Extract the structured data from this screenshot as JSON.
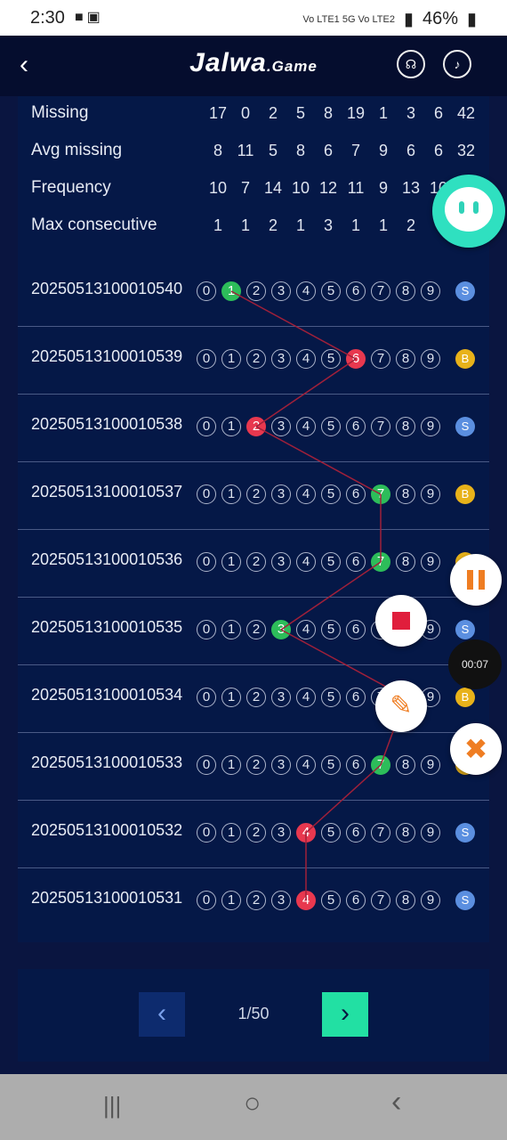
{
  "status_bar": {
    "time": "2:30",
    "left_icons": [
      "video-camera-icon",
      "image-icon"
    ],
    "network_label": "Vo LTE1 5G Vo LTE2",
    "battery": "46%"
  },
  "header": {
    "logo_main": "Jalwa",
    "logo_suffix": ".Game",
    "back_icon": "‹"
  },
  "stats": [
    {
      "label": "Missing",
      "values": [
        "17",
        "0",
        "2",
        "5",
        "8",
        "19",
        "1",
        "3",
        "6",
        "42"
      ]
    },
    {
      "label": "Avg missing",
      "values": [
        "8",
        "11",
        "5",
        "8",
        "6",
        "7",
        "9",
        "6",
        "6",
        "32"
      ]
    },
    {
      "label": "Frequency",
      "values": [
        "10",
        "7",
        "14",
        "10",
        "12",
        "11",
        "9",
        "13",
        "10",
        ""
      ]
    },
    {
      "label": "Max consecutive",
      "values": [
        "1",
        "1",
        "2",
        "1",
        "3",
        "1",
        "1",
        "2",
        "",
        ""
      ]
    }
  ],
  "draws": [
    {
      "issue": "20250513100010540",
      "number": 1,
      "color": "green",
      "size": "S"
    },
    {
      "issue": "20250513100010539",
      "number": 6,
      "color": "red",
      "size": "B"
    },
    {
      "issue": "20250513100010538",
      "number": 2,
      "color": "red",
      "size": "S"
    },
    {
      "issue": "20250513100010537",
      "number": 7,
      "color": "green",
      "size": "B"
    },
    {
      "issue": "20250513100010536",
      "number": 7,
      "color": "green",
      "size": "B"
    },
    {
      "issue": "20250513100010535",
      "number": 3,
      "color": "green",
      "size": "S"
    },
    {
      "issue": "20250513100010534",
      "number": 8,
      "color": "red",
      "size": "B"
    },
    {
      "issue": "20250513100010533",
      "number": 7,
      "color": "green",
      "size": "B"
    },
    {
      "issue": "20250513100010532",
      "number": 4,
      "color": "red",
      "size": "S"
    },
    {
      "issue": "20250513100010531",
      "number": 4,
      "color": "red",
      "size": "S"
    }
  ],
  "colors": {
    "small": "#5b8fe0",
    "big": "#e8b21a",
    "hit_green": "#2dbd5a",
    "hit_red": "#e8384f",
    "trend_line": "#a0203a"
  },
  "overlay": {
    "timer": "00:07"
  },
  "pagination": {
    "text": "1/50"
  },
  "nav": {
    "recents": "|||",
    "home": "○",
    "back": "‹"
  }
}
